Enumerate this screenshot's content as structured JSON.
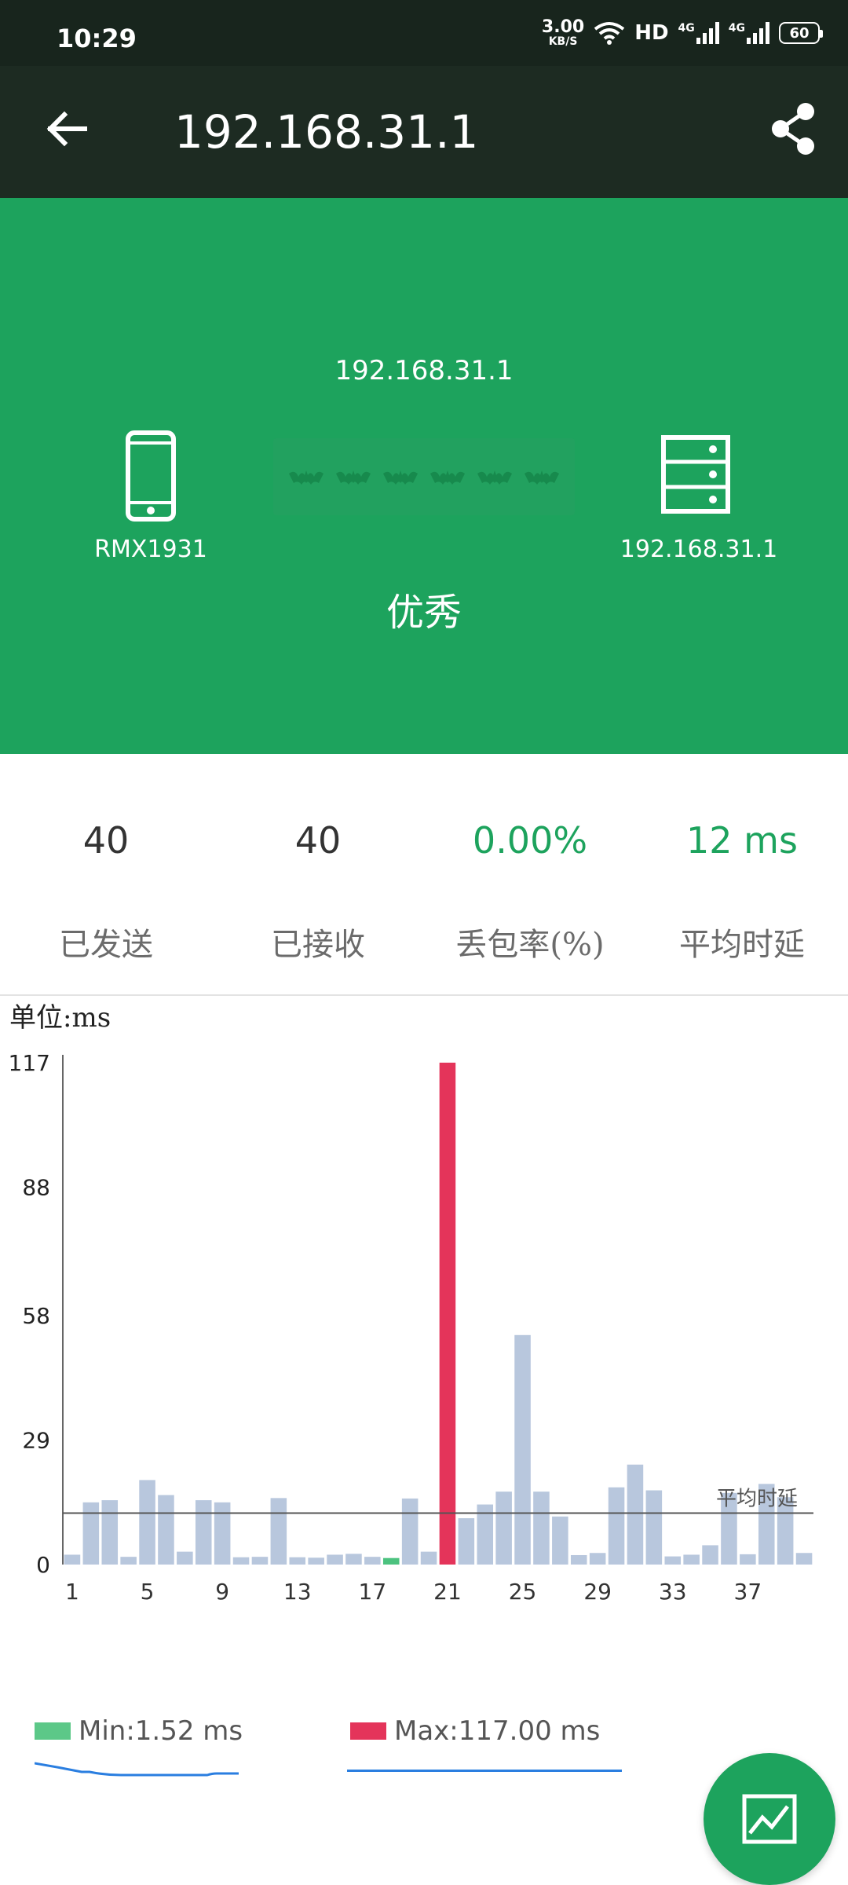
{
  "status_bar": {
    "time": "10:29",
    "net_speed_value": "3.00",
    "net_speed_unit": "KB/S",
    "hd_label": "HD",
    "signal1_label": "4G",
    "signal2_label": "4G",
    "battery": "60"
  },
  "app_bar": {
    "title": "192.168.31.1",
    "back_icon": "arrow-left-icon",
    "share_icon": "share-icon"
  },
  "hero": {
    "target_ip": "192.168.31.1",
    "device_name": "RMX1931",
    "server_name": "192.168.31.1",
    "quality": "优秀",
    "colors": {
      "background": "#1da35d"
    }
  },
  "stats": {
    "sent": "40",
    "received": "40",
    "loss": "0.00%",
    "avg": "12 ms"
  },
  "stat_labels": {
    "sent": "已发送",
    "received": "已接收",
    "loss": "丢包率(%)",
    "avg": "平均时延"
  },
  "chart_unit": "单位:ms",
  "chart_data": {
    "type": "bar",
    "x": [
      1,
      2,
      3,
      4,
      5,
      6,
      7,
      8,
      9,
      10,
      11,
      12,
      13,
      14,
      15,
      16,
      17,
      18,
      19,
      20,
      21,
      22,
      23,
      24,
      25,
      26,
      27,
      28,
      29,
      30,
      31,
      32,
      33,
      34,
      35,
      36,
      37,
      38,
      39,
      40
    ],
    "values": [
      2.3,
      14.5,
      15,
      1.8,
      19.7,
      16.2,
      3,
      15,
      14.5,
      1.7,
      1.8,
      15.5,
      1.7,
      1.6,
      2.3,
      2.5,
      1.8,
      1.52,
      15.4,
      3,
      117,
      10.8,
      14,
      17,
      53.5,
      17,
      11.2,
      2.2,
      2.7,
      18,
      23.3,
      17.3,
      1.9,
      2.3,
      4.5,
      16.7,
      2.4,
      18.8,
      15.7,
      2.7
    ],
    "x_tick_labels": [
      "1",
      "5",
      "9",
      "13",
      "17",
      "21",
      "25",
      "29",
      "33",
      "37"
    ],
    "y_tick_labels": [
      "0",
      "29",
      "58",
      "88",
      "117"
    ],
    "y_ticks": [
      0,
      29,
      58,
      88,
      117
    ],
    "ylim": [
      0,
      117
    ],
    "average": 12,
    "average_label": "平均时延",
    "highlight": {
      "min_index": 17,
      "max_index": 20
    },
    "colors": {
      "bar": "#b8c7dd",
      "min": "#4cc27f",
      "max": "#e4345a",
      "avg_line": "#555555"
    }
  },
  "legend": {
    "min_label": "Min:1.52 ms",
    "max_label": "Max:117.00 ms",
    "min_color": "#5cc888",
    "max_color": "#e4345a"
  },
  "fab": {
    "icon": "line-chart-icon"
  }
}
